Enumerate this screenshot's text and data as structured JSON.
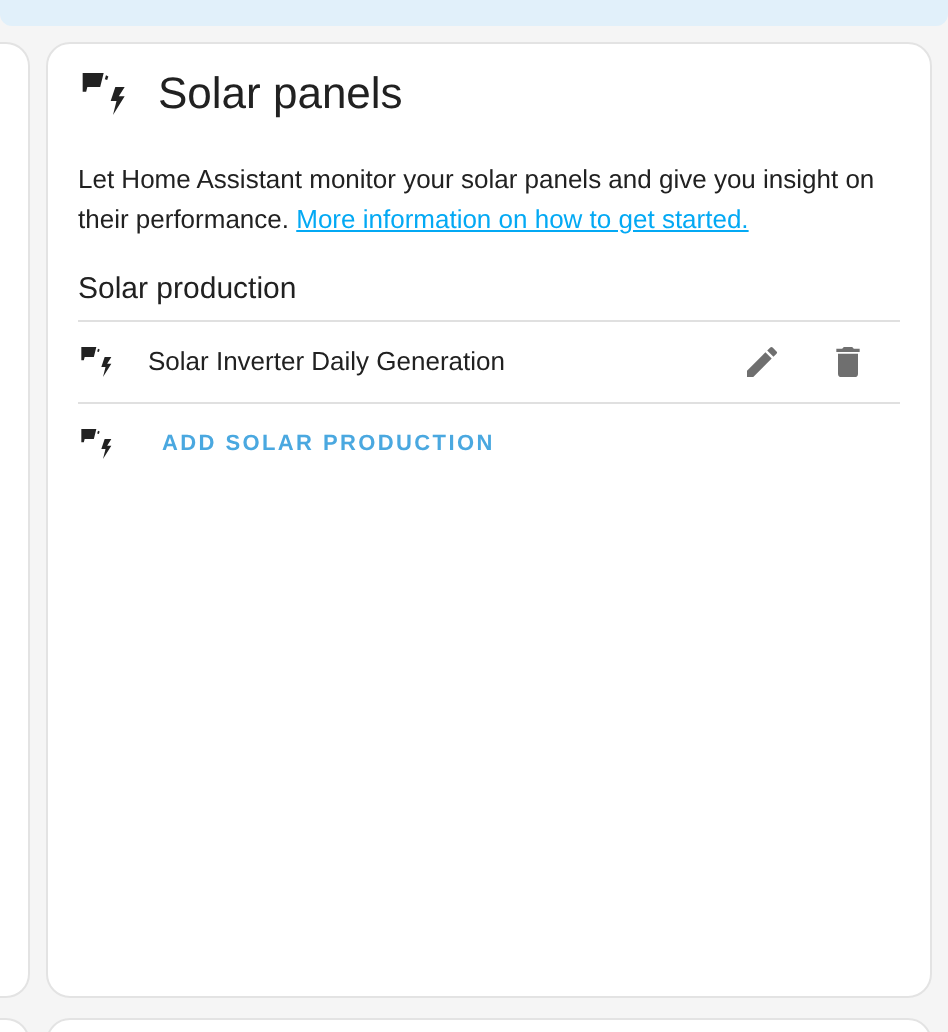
{
  "card": {
    "title": "Solar panels",
    "description": "Let Home Assistant monitor your solar panels and give you insight on their performance.",
    "link": "More information on how to get started.",
    "section": "Solar production",
    "sources": [
      {
        "name": "Solar Inverter Daily Generation"
      }
    ],
    "add_button": "ADD SOLAR PRODUCTION"
  }
}
